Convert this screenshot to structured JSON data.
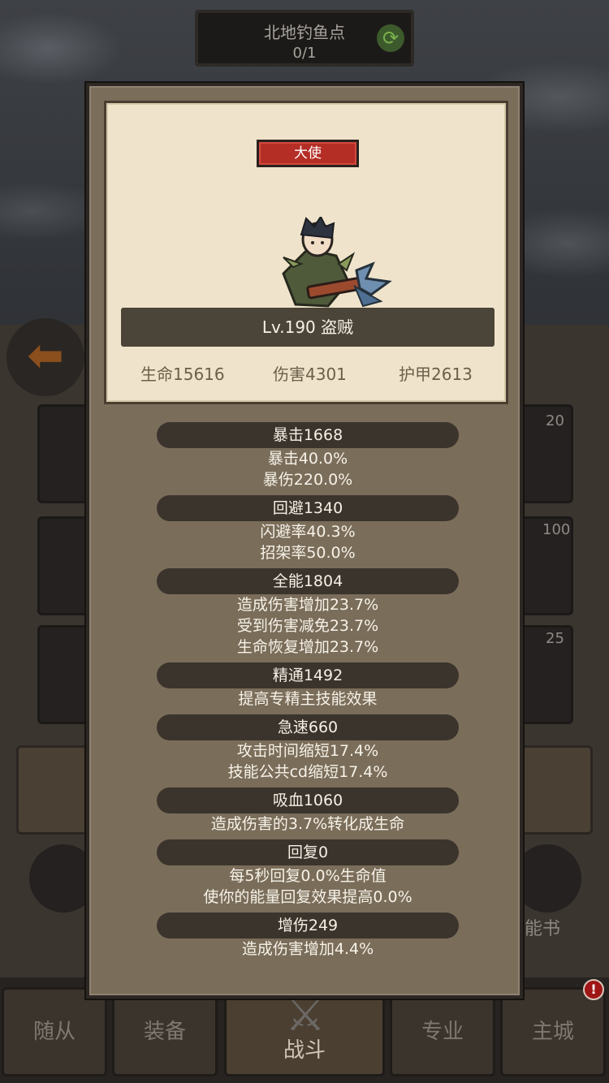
{
  "background": {
    "location_name": "北地钓鱼点",
    "location_count": "0/1",
    "refresh_icon": "refresh-icon",
    "slot_counts": [
      "20",
      "100",
      "25"
    ],
    "skill_label_fragment": "能书",
    "alert_badge": "!"
  },
  "bottom_nav": {
    "tabs": [
      "随从",
      "装备",
      "战斗",
      "专业",
      "主城"
    ],
    "active": "战斗"
  },
  "hero_card": {
    "rank_badge": "大使",
    "level_line": "Lv.190 盗贼",
    "life": "生命15616",
    "damage": "伤害4301",
    "armor": "护甲2613"
  },
  "stats": [
    {
      "header": "暴击1668",
      "lines": [
        "暴击40.0%",
        "暴伤220.0%"
      ]
    },
    {
      "header": "回避1340",
      "lines": [
        "闪避率40.3%",
        "招架率50.0%"
      ]
    },
    {
      "header": "全能1804",
      "lines": [
        "造成伤害增加23.7%",
        "受到伤害减免23.7%",
        "生命恢复增加23.7%"
      ]
    },
    {
      "header": "精通1492",
      "lines": [
        "提高专精主技能效果"
      ]
    },
    {
      "header": "急速660",
      "lines": [
        "攻击时间缩短17.4%",
        "技能公共cd缩短17.4%"
      ]
    },
    {
      "header": "吸血1060",
      "lines": [
        "造成伤害的3.7%转化成生命"
      ]
    },
    {
      "header": "回复0",
      "lines": [
        "每5秒回复0.0%生命值",
        "使你的能量回复效果提高0.0%"
      ]
    },
    {
      "header": "增伤249",
      "lines": [
        "造成伤害增加4.4%"
      ]
    }
  ],
  "colors": {
    "panel": "#7a6d5a",
    "card": "#efe4cb",
    "badge": "#b52e26",
    "header_pill": "#3b342c"
  }
}
